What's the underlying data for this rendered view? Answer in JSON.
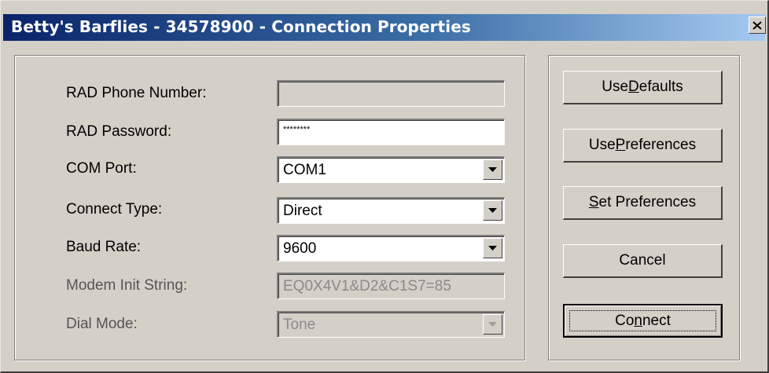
{
  "window": {
    "title": "Betty's Barflies - 34578900 - Connection Properties",
    "close_icon": "close-icon"
  },
  "form": {
    "rad_phone_label": "RAD Phone Number:",
    "rad_phone_value": "",
    "rad_password_label": "RAD Password:",
    "rad_password_value": "********",
    "com_port_label": "COM Port:",
    "com_port_value": "COM1",
    "connect_type_label": "Connect Type:",
    "connect_type_value": "Direct",
    "baud_rate_label": "Baud Rate:",
    "baud_rate_value": "9600",
    "modem_init_label": "Modem Init String:",
    "modem_init_value": "EQ0X4V1&D2&C1S7=85",
    "dial_mode_label": "Dial Mode:",
    "dial_mode_value": "Tone"
  },
  "buttons": {
    "use_defaults": {
      "pre": "Use ",
      "key": "D",
      "post": "efaults"
    },
    "use_preferences": {
      "pre": "Use ",
      "key": "P",
      "post": "references"
    },
    "set_preferences": {
      "pre": "",
      "key": "S",
      "post": "et Preferences"
    },
    "cancel": {
      "pre": "Cancel",
      "key": "",
      "post": ""
    },
    "connect": {
      "pre": "Co",
      "key": "n",
      "post": "nect"
    }
  }
}
